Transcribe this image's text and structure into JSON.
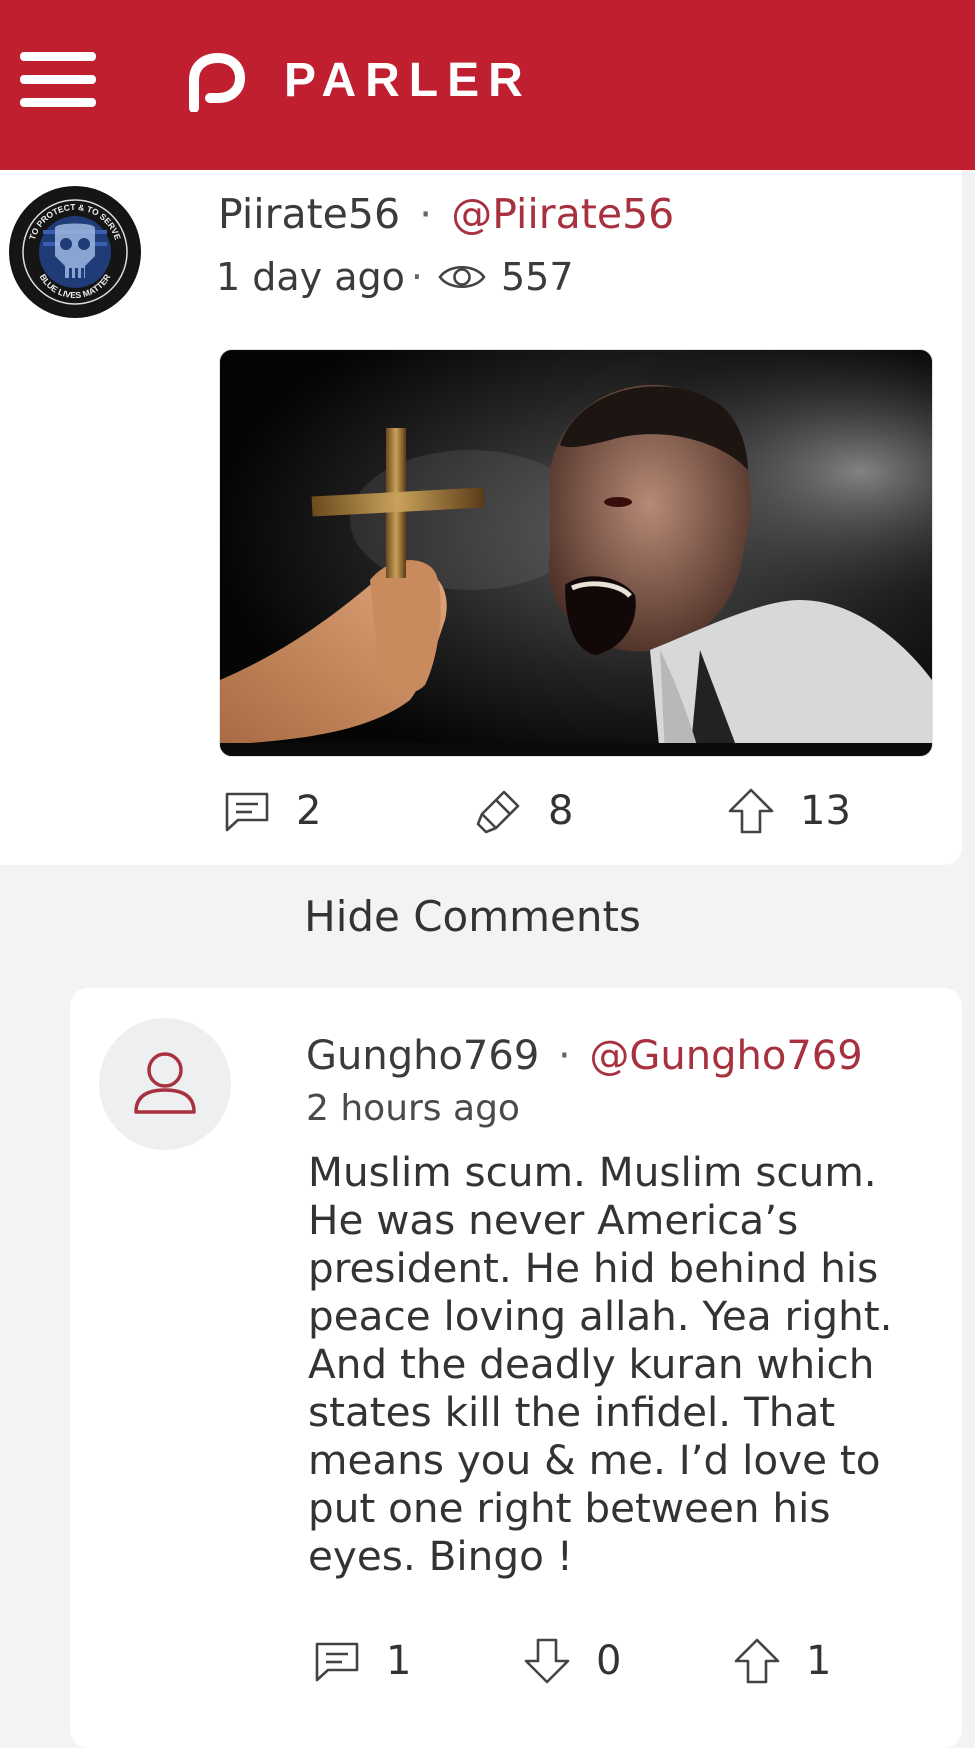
{
  "header": {
    "logo_text": "PARLER",
    "brand_color": "#c01f2f"
  },
  "post": {
    "author_name": "Piirate56",
    "author_handle": "@Piirate56",
    "separator": "·",
    "timestamp": "1 day ago",
    "views": "557",
    "avatar_text_top": "TO PROTECT & TO SERVE",
    "avatar_text_bottom": "BLUE LIVES MATTER",
    "comment_count": "2",
    "echo_count": "8",
    "upvote_count": "13"
  },
  "comments_toggle": "Hide Comments",
  "comment": {
    "author_name": "Gungho769",
    "author_handle": "@Gungho769",
    "separator": "·",
    "timestamp": "2 hours ago",
    "body": "Muslim scum. Muslim scum.\nHe was never America’s\npresident. He hid behind his\npeace loving allah. Yea right.\nAnd the deadly kuran which\nstates kill the infidel. That\nmeans you & me. I’d love to\nput one right between his\neyes. Bingo !",
    "reply_count": "1",
    "downvote_count": "0",
    "upvote_count": "1"
  },
  "icons": {
    "menu": "hamburger-menu-icon",
    "logo": "parler-logo-icon",
    "views": "eye-icon",
    "comment": "comment-bubble-icon",
    "echo": "echo-megaphone-icon",
    "upvote": "arrow-up-icon",
    "downvote": "arrow-down-icon",
    "user": "user-outline-icon"
  },
  "colors": {
    "handle": "#a8313f",
    "background": "#f3f3f3",
    "card": "#ffffff"
  }
}
